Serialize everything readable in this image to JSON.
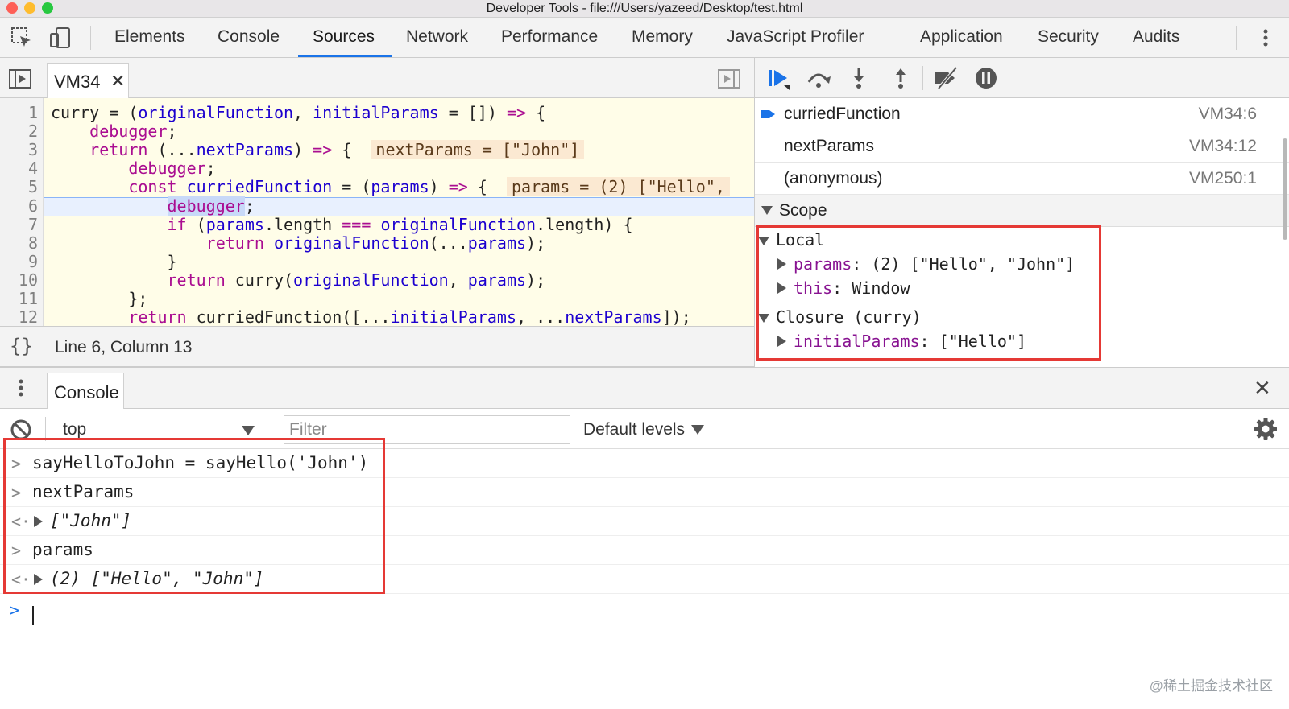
{
  "window": {
    "title": "Developer Tools - file:///Users/yazeed/Desktop/test.html",
    "colors": {
      "close": "#fe5f57",
      "minimize": "#febc2e",
      "zoom": "#28c840"
    }
  },
  "tabs": {
    "elements": "Elements",
    "console": "Console",
    "sources": "Sources",
    "network": "Network",
    "performance": "Performance",
    "memory": "Memory",
    "js_profiler": "JavaScript Profiler",
    "application": "Application",
    "security": "Security",
    "audits": "Audits",
    "active": "Sources"
  },
  "source_file": {
    "name": "VM34",
    "close": "✕"
  },
  "editor": {
    "line_numbers": [
      "1",
      "2",
      "3",
      "4",
      "5",
      "6",
      "7",
      "8",
      "9",
      "10",
      "11",
      "12"
    ],
    "current_line": 6,
    "inline_values": {
      "line3": "nextParams = [\"John\"]",
      "line5": "params = (2) [\"Hello\","
    }
  },
  "status": {
    "braces": "{}",
    "position": "Line 6, Column 13"
  },
  "call_stack": [
    {
      "name": "curriedFunction",
      "location": "VM34:6",
      "current": true
    },
    {
      "name": "nextParams",
      "location": "VM34:12",
      "current": false
    },
    {
      "name": "(anonymous)",
      "location": "VM250:1",
      "current": false
    }
  ],
  "scope": {
    "title": "Scope",
    "local_title": "Local",
    "local": [
      {
        "key": "params",
        "value": "(2) [\"Hello\", \"John\"]"
      },
      {
        "key": "this",
        "value": "Window"
      }
    ],
    "closure_title": "Closure (curry)",
    "closure": [
      {
        "key": "initialParams",
        "value": "[\"Hello\"]"
      }
    ]
  },
  "drawer": {
    "tab": "Console",
    "close": "✕"
  },
  "console_toolbar": {
    "context": "top",
    "filter_placeholder": "Filter",
    "levels": "Default levels"
  },
  "console": {
    "entries": [
      {
        "kind": "input",
        "text": "sayHelloToJohn = sayHello('John')"
      },
      {
        "kind": "input",
        "text": "nextParams"
      },
      {
        "kind": "output",
        "text": "[\"John\"]"
      },
      {
        "kind": "input",
        "text": "params"
      },
      {
        "kind": "output",
        "text": "(2) [\"Hello\", \"John\"]"
      }
    ]
  },
  "watermark": "@稀土掘金技术社区"
}
